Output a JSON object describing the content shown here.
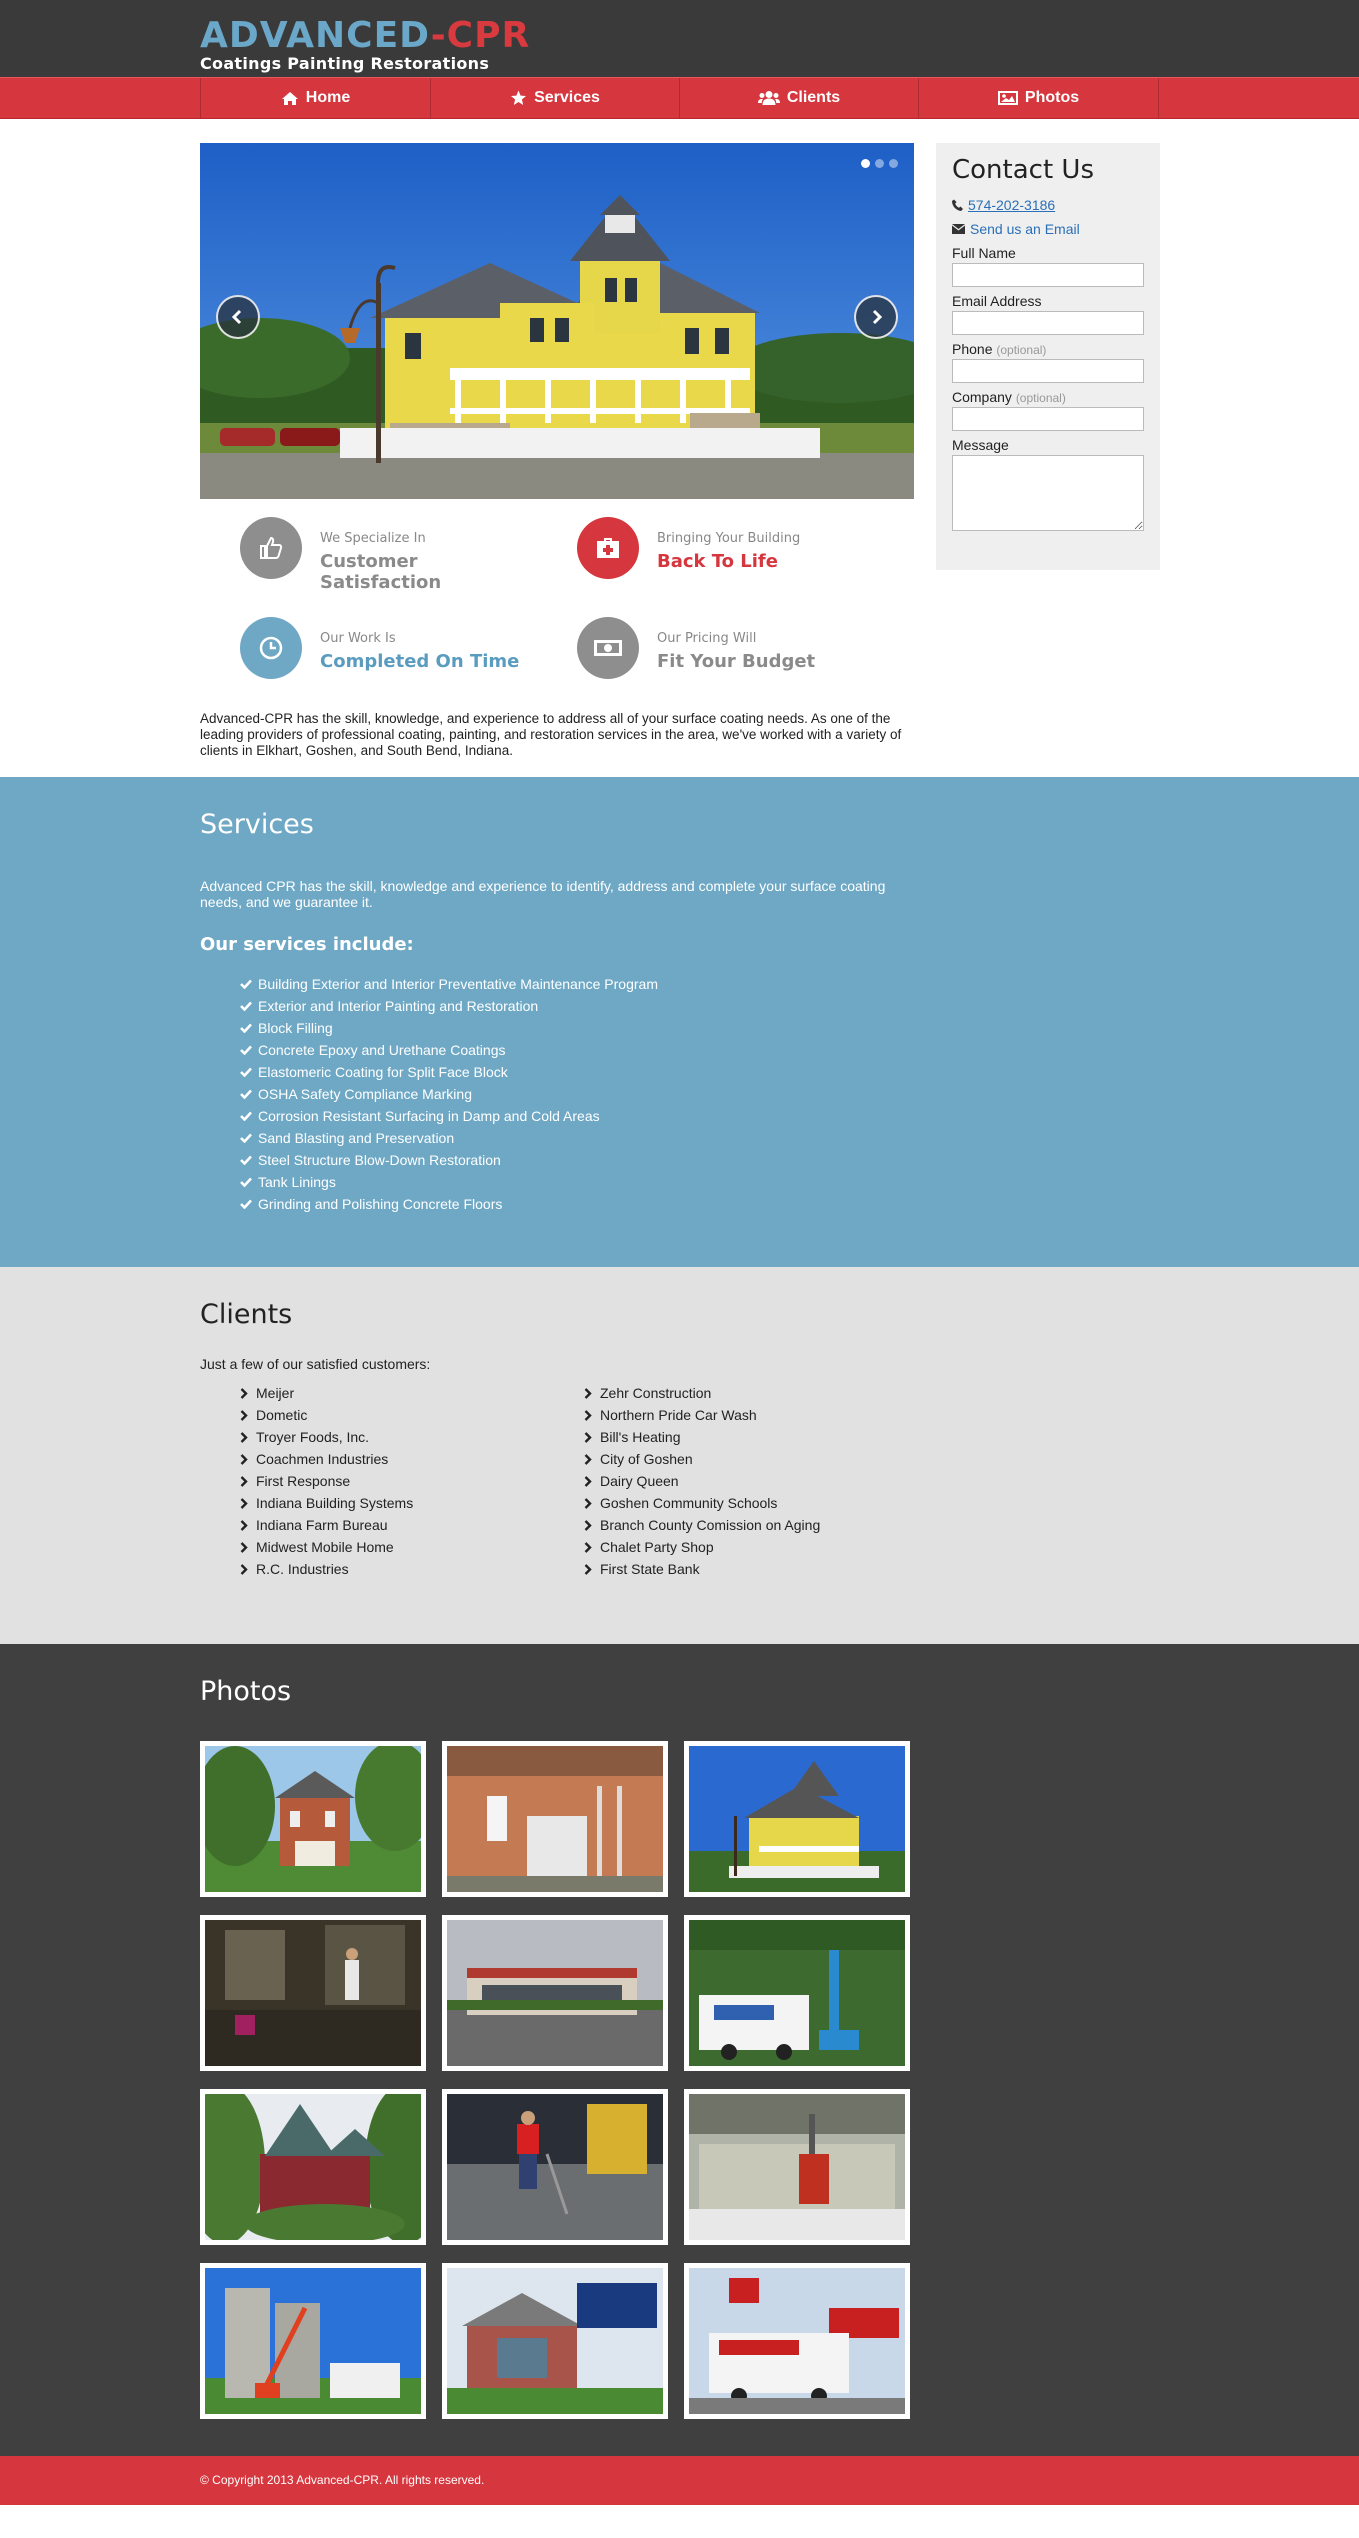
{
  "brand": {
    "name_part1": "ADVANCED",
    "name_dash": "-",
    "name_part2": "CPR",
    "tagline": "Coatings Painting Restorations",
    "color_blue": "#6aa7c8",
    "color_red": "#d83a3f"
  },
  "nav": [
    {
      "label": "Home",
      "icon": "home-icon"
    },
    {
      "label": "Services",
      "icon": "star-icon"
    },
    {
      "label": "Clients",
      "icon": "users-icon"
    },
    {
      "label": "Photos",
      "icon": "picture-icon"
    }
  ],
  "slider": {
    "slide_count": 3,
    "active_index": 0,
    "image": "yellow-victorian-house"
  },
  "features": [
    {
      "small": "We Specialize In",
      "big": "Customer Satisfaction",
      "icon": "thumbs-up-icon",
      "color": "#8e8e8e"
    },
    {
      "small": "Bringing Your Building",
      "big": "Back To Life",
      "icon": "medkit-icon",
      "color": "#d6363e"
    },
    {
      "small": "Our Work Is",
      "big": "Completed On Time",
      "icon": "clock-icon",
      "color": "#6ea8c5"
    },
    {
      "small": "Our Pricing Will",
      "big": "Fit Your Budget",
      "icon": "money-icon",
      "color": "#8e8e8e"
    }
  ],
  "intro": "Advanced-CPR has the skill, knowledge, and experience to address all of your surface coating needs. As one of the leading providers of professional coating, painting, and restoration services in the area, we've worked with a variety of clients in Elkhart, Goshen, and South Bend, Indiana.",
  "contact": {
    "title": "Contact Us",
    "phone": "574-202-3186",
    "email_link": "Send us an Email",
    "fields": {
      "full_name": "Full Name",
      "email": "Email Address",
      "phone": "Phone",
      "company": "Company",
      "message": "Message",
      "optional": "(optional)"
    }
  },
  "services": {
    "title": "Services",
    "lead": "Advanced CPR has the skill, knowledge and experience to identify, address and complete your surface coating needs, and we guarantee it.",
    "subtitle": "Our services include:",
    "items": [
      "Building Exterior and Interior Preventative Maintenance Program",
      "Exterior and Interior Painting and Restoration",
      "Block Filling",
      "Concrete Epoxy and Urethane Coatings",
      "Elastomeric Coating for Split Face Block",
      "OSHA Safety Compliance Marking",
      "Corrosion Resistant Surfacing in Damp and Cold Areas",
      "Sand Blasting and Preservation",
      "Steel Structure Blow-Down Restoration",
      "Tank Linings",
      "Grinding and Polishing Concrete Floors"
    ]
  },
  "clients": {
    "title": "Clients",
    "lead": "Just a few of our satisfied customers:",
    "col1": [
      "Meijer",
      "Dometic",
      "Troyer Foods, Inc.",
      "Coachmen Industries",
      "First Response",
      "Indiana Building Systems",
      "Indiana Farm Bureau",
      "Midwest Mobile Home",
      "R.C. Industries"
    ],
    "col2": [
      "Zehr Construction",
      "Northern Pride Car Wash",
      "Bill's Heating",
      "City of Goshen",
      "Dairy Queen",
      "Goshen Community Schools",
      "Branch County Comission on Aging",
      "Chalet Party Shop",
      "First State Bank"
    ]
  },
  "photos": {
    "title": "Photos",
    "thumbs": [
      "brick-victorian-house",
      "brick-building-ladder",
      "yellow-victorian-house",
      "basement-cleaning",
      "commercial-building",
      "trailer-and-lift",
      "turret-house",
      "floor-coating-worker",
      "industrial-interior-lift",
      "silo-with-lift",
      "first-state-bank",
      "kfc-trailer"
    ]
  },
  "footer": {
    "copyright": "© Copyright 2013 Advanced-CPR. All rights reserved."
  }
}
